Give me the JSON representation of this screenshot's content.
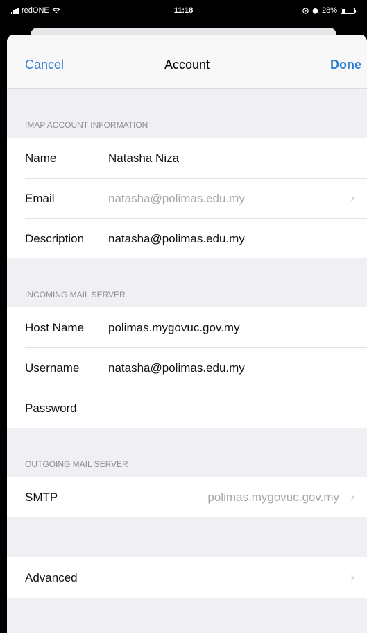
{
  "status": {
    "carrier": "redONE",
    "time": "11:18",
    "battery": "28%",
    "battery_level": 0.28
  },
  "nav": {
    "cancel": "Cancel",
    "title": "Account",
    "done": "Done"
  },
  "imap": {
    "header": "IMAP ACCOUNT INFORMATION",
    "name_label": "Name",
    "name_value": "Natasha Niza",
    "email_label": "Email",
    "email_value": "natasha@polimas.edu.my",
    "description_label": "Description",
    "description_value": "natasha@polimas.edu.my"
  },
  "incoming": {
    "header": "INCOMING MAIL SERVER",
    "host_label": "Host Name",
    "host_value": "polimas.mygovuc.gov.my",
    "username_label": "Username",
    "username_value": "natasha@polimas.edu.my",
    "password_label": "Password"
  },
  "outgoing": {
    "header": "OUTGOING MAIL SERVER",
    "smtp_label": "SMTP",
    "smtp_value": "polimas.mygovuc.gov.my"
  },
  "advanced": {
    "label": "Advanced"
  },
  "icons": {
    "chevron": "›",
    "wifi": "wifi-icon",
    "alarm": "alarm-icon"
  }
}
